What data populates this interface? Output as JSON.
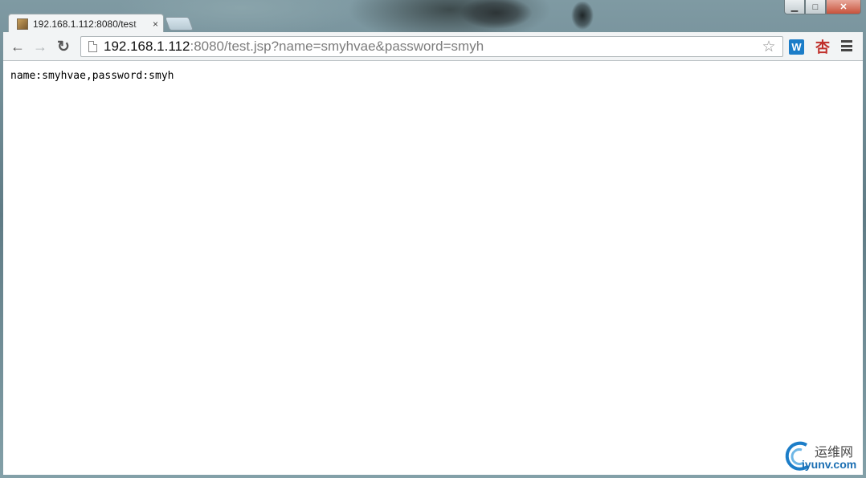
{
  "window": {
    "controls": {
      "minimize": "▁",
      "maximize": "□",
      "close": "✕"
    }
  },
  "tab": {
    "title": "192.168.1.112:8080/test",
    "close": "×"
  },
  "toolbar": {
    "back": "←",
    "forward": "→",
    "reload": "↻",
    "url_host": "192.168.1.112",
    "url_rest": ":8080/test.jsp?name=smyhvae&password=smyh",
    "star": "☆",
    "ext_w": "W",
    "ext_x": "杏"
  },
  "content": {
    "text": "name:smyhvae,password:smyh"
  },
  "watermark": {
    "cn": "运维网",
    "en": "iyunv.com"
  },
  "colors": {
    "accent": "#1c7dc8",
    "watermark": "#1c6fb3",
    "ext_red": "#c0302b"
  }
}
